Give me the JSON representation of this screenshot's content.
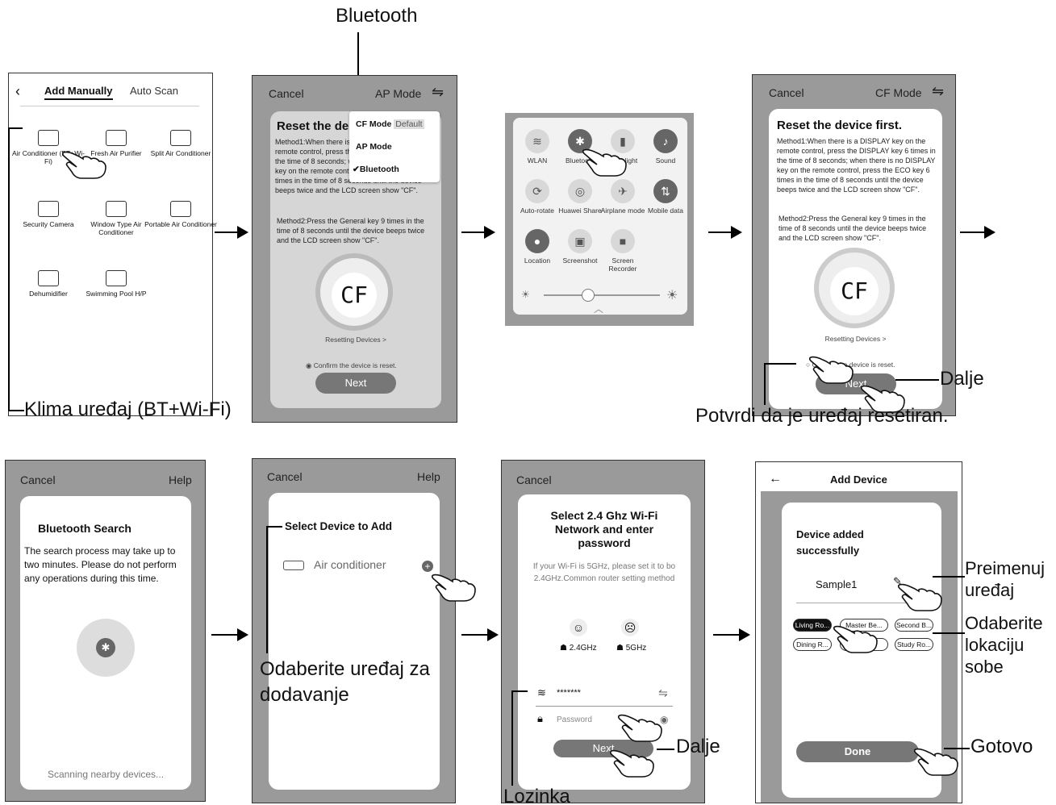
{
  "top_label": "Bluetooth",
  "panel1": {
    "tab_active": "Add Manually",
    "tab_inactive": "Auto Scan",
    "devices": [
      {
        "label": "Air Conditioner (BT+Wi-Fi)",
        "icon": "air-conditioner-icon"
      },
      {
        "label": "Fresh Air Purifier",
        "icon": "purifier-icon"
      },
      {
        "label": "Split Air Conditioner",
        "icon": "split-ac-icon"
      },
      {
        "label": "Security Camera",
        "icon": "camera-icon"
      },
      {
        "label": "Window Type Air Conditioner",
        "icon": "window-ac-icon"
      },
      {
        "label": "Portable Air Conditioner",
        "icon": "portable-ac-icon"
      },
      {
        "label": "Dehumidifier",
        "icon": "dehumidifier-icon"
      },
      {
        "label": "Swimming Pool H/P",
        "icon": "pool-icon"
      }
    ],
    "callout": "Klima uređaj (BT+Wi-Fi)"
  },
  "panel2": {
    "cancel": "Cancel",
    "mode": "AP Mode",
    "title": "Reset the de",
    "menu": [
      {
        "label": "CF Mode",
        "tag": "Default"
      },
      {
        "label": "AP Mode",
        "tag": ""
      },
      {
        "label": "Bluetooth",
        "tag": ""
      }
    ],
    "method1": "Method1:When there is a DISPLAY key on the remote control, press the DISPLAY key 6 times in the time of 8 seconds; when there is no DISPLAY key on the remote control, press the ECO key 6 times in the time of 8 seconds until the device beeps twice and the LCD screen show \"CF\".",
    "method2": "Method2:Press the General key 9 times in the time of 8 seconds until the device beeps twice and the LCD screen show \"CF\".",
    "lcd": "CF",
    "resetting": "Resetting Devices >",
    "confirm": "Confirm the device is reset.",
    "next": "Next"
  },
  "panel3": {
    "tiles": [
      {
        "label": "WLAN",
        "icon": "wifi-icon"
      },
      {
        "label": "Bluetooth",
        "icon": "bluetooth-icon"
      },
      {
        "label": "Flashlight",
        "icon": "flashlight-icon"
      },
      {
        "label": "Sound",
        "icon": "bell-icon"
      },
      {
        "label": "Auto-rotate",
        "icon": "rotate-icon"
      },
      {
        "label": "Huawei Share",
        "icon": "share-icon"
      },
      {
        "label": "Airplane mode",
        "icon": "airplane-icon"
      },
      {
        "label": "Mobile data",
        "icon": "mobile-data-icon"
      },
      {
        "label": "Location",
        "icon": "location-icon"
      },
      {
        "label": "Screenshot",
        "icon": "screenshot-icon"
      },
      {
        "label": "Screen Recorder",
        "icon": "recorder-icon"
      }
    ],
    "brightness_level": 0.38
  },
  "panel4": {
    "cancel": "Cancel",
    "mode": "CF Mode",
    "title": "Reset the device first.",
    "method1": "Method1:When there is a DISPLAY key on the remote control, press the DISPLAY key 6 times in the time of 8 seconds; when there is no DISPLAY key on the remote control, press the ECO key 6 times in the time of 8 seconds until the device beeps twice and the LCD screen show \"CF\".",
    "method2": "Method2:Press the General key 9 times in the time of 8 seconds until the device beeps twice and the LCD screen show \"CF\".",
    "lcd": "CF",
    "resetting": "Resetting Devices >",
    "confirm": "Confirm the device is reset.",
    "next": "Next",
    "callout_next": "Dalje",
    "callout_confirm": "Potvrdi da je uređaj resetiran."
  },
  "panel5": {
    "cancel": "Cancel",
    "help": "Help",
    "title": "Bluetooth Search",
    "body": "The search process may take up to two minutes. Please do not perform any operations during this time.",
    "scanning": "Scanning nearby devices..."
  },
  "panel6": {
    "cancel": "Cancel",
    "help": "Help",
    "title": "Select Device to Add",
    "device": "Air conditioner",
    "callout_line1": "Odaberite uređaj za",
    "callout_line2": "dodavanje"
  },
  "panel7": {
    "cancel": "Cancel",
    "title": "Select 2.4 Ghz Wi-Fi Network and enter password",
    "hint": "If your Wi-Fi is 5GHz, please set it to bo 2.4GHz.Common router setting method",
    "band1": "2.4GHz",
    "band2": "5GHz",
    "ssid": "*******",
    "password_placeholder": "Password",
    "next": "Next",
    "callout_next": "Dalje",
    "callout_password": "Lozinka"
  },
  "panel8": {
    "title": "Add Device",
    "success": "Device added successfully",
    "name": "Sample1",
    "rooms": [
      "Living Ro...",
      "Master Be...",
      "Second B...",
      "Dining R...",
      "Kitchen",
      "Study Ro..."
    ],
    "done": "Done",
    "callout_rename_1": "Preimenuj",
    "callout_rename_2": "uređaj",
    "callout_loc_1": "Odaberite",
    "callout_loc_2": "lokaciju",
    "callout_loc_3": "sobe",
    "callout_done": "Gotovo"
  }
}
